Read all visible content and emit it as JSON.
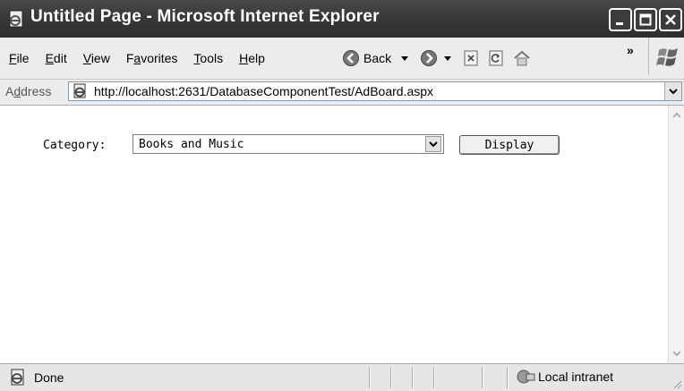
{
  "window": {
    "title": "Untitled Page - Microsoft Internet Explorer"
  },
  "menu": {
    "items": [
      {
        "label": "File",
        "underline": "F",
        "rest": "ile"
      },
      {
        "label": "Edit",
        "underline": "E",
        "rest": "dit"
      },
      {
        "label": "View",
        "underline": "V",
        "rest": "iew"
      },
      {
        "label": "Favorites",
        "pre": "F",
        "underline": "a",
        "rest": "vorites"
      },
      {
        "label": "Tools",
        "underline": "T",
        "rest": "ools"
      },
      {
        "label": "Help",
        "underline": "H",
        "rest": "elp"
      }
    ]
  },
  "toolbar": {
    "back_label": "Back",
    "chevron": "»"
  },
  "address": {
    "label_pre": "A",
    "label_u": "d",
    "label_rest": "dress",
    "url": "http://localhost:2631/DatabaseComponentTest/AdBoard.aspx"
  },
  "page": {
    "category_label": "Category:",
    "category_value": "Books and Music",
    "display_button": "Display"
  },
  "status": {
    "text": "Done",
    "zone": "Local intranet"
  }
}
